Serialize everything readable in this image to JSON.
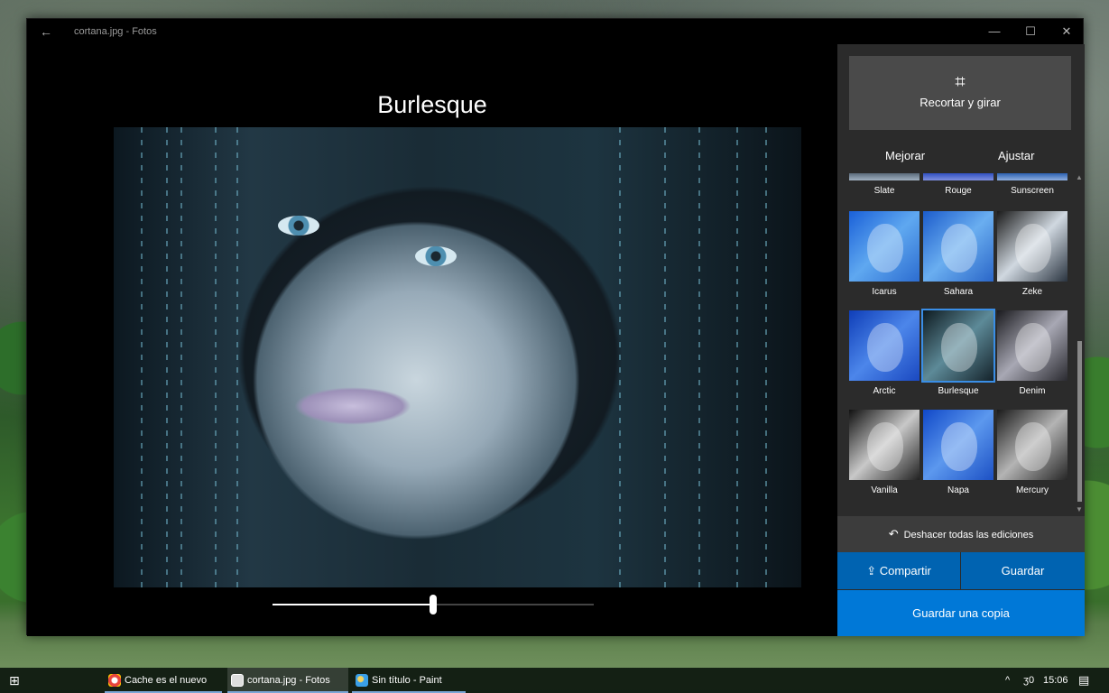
{
  "window": {
    "title": "cortana.jpg - Fotos",
    "back_glyph": "←",
    "minimize_glyph": "—",
    "maximize_glyph": "☐",
    "close_glyph": "✕"
  },
  "editor": {
    "filter_title": "Burlesque",
    "intensity": 0.5
  },
  "panel": {
    "crop_label": "Recortar y girar",
    "tabs": [
      "Mejorar",
      "Ajustar"
    ],
    "filters": [
      {
        "label": "Slate"
      },
      {
        "label": "Rouge"
      },
      {
        "label": "Sunscreen"
      },
      {
        "label": "Icarus"
      },
      {
        "label": "Sahara"
      },
      {
        "label": "Zeke"
      },
      {
        "label": "Arctic"
      },
      {
        "label": "Burlesque",
        "selected": true
      },
      {
        "label": "Denim"
      },
      {
        "label": "Vanilla"
      },
      {
        "label": "Napa"
      },
      {
        "label": "Mercury"
      }
    ],
    "undo_label": "Deshacer todas las ediciones",
    "share_label": "Compartir",
    "save_label": "Guardar",
    "save_copy_label": "Guardar una copia"
  },
  "taskbar": {
    "items": [
      {
        "label": "Cache es el nuevo On..."
      },
      {
        "label": "cortana.jpg - Fotos",
        "active": true
      },
      {
        "label": "Sin título - Paint"
      }
    ],
    "volume": "ʒ0",
    "clock": "15:06"
  },
  "colors": {
    "accent": "#0078d7",
    "accent_dark": "#0063b1",
    "panel_bg": "#2b2b2b",
    "selection": "#3a8ee6"
  }
}
